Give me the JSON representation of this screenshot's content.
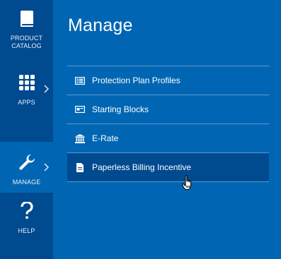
{
  "nav": {
    "items": [
      {
        "label_line1": "PRODUCT",
        "label_line2": "CATALOG",
        "icon": "book-icon"
      },
      {
        "label_line1": "APPS",
        "label_line2": "",
        "icon": "grid-icon"
      },
      {
        "label_line1": "MANAGE",
        "label_line2": "",
        "icon": "wrench-icon"
      },
      {
        "label_line1": "HELP",
        "label_line2": "",
        "icon": "question-icon"
      }
    ]
  },
  "panel": {
    "title": "Manage",
    "menu": [
      {
        "label": "Protection Plan Profiles",
        "icon": "list-icon"
      },
      {
        "label": "Starting Blocks",
        "icon": "card-icon"
      },
      {
        "label": "E-Rate",
        "icon": "bank-icon"
      },
      {
        "label": "Paperless Billing Incentive",
        "icon": "document-icon"
      }
    ]
  },
  "colors": {
    "rail": "#004a8f",
    "panel": "#0066b3",
    "divider": "#5d99cf",
    "hover": "#004a8f"
  }
}
